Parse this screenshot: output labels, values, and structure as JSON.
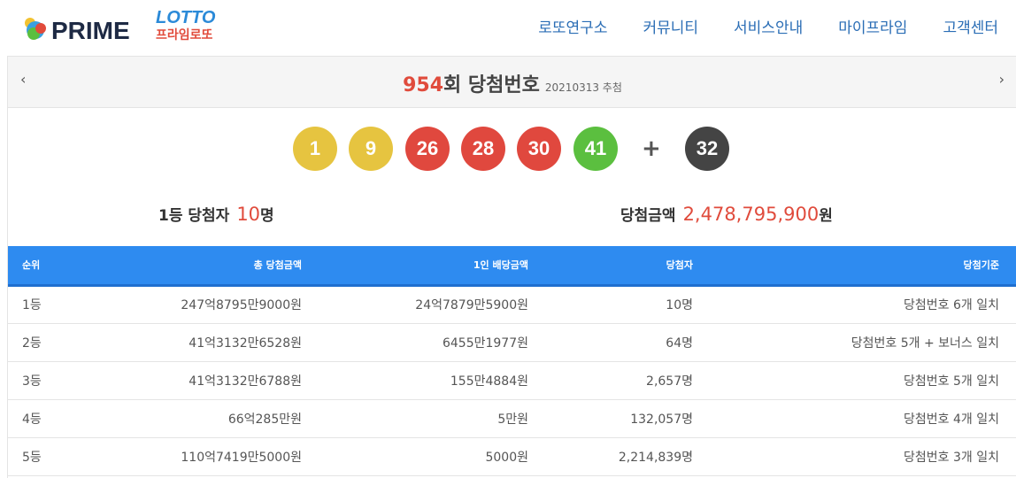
{
  "brand": {
    "name": "PRIME",
    "lotto": "LOTTO",
    "kr": "프라임로또"
  },
  "nav": [
    "로또연구소",
    "커뮤니티",
    "서비스안내",
    "마이프라임",
    "고객센터"
  ],
  "round": {
    "number": "954",
    "suffix": "회 당첨번호",
    "date": "20210313 추첨",
    "prev_icon": "‹",
    "next_icon": "›"
  },
  "balls": [
    {
      "num": "1",
      "color": "#e6c440"
    },
    {
      "num": "9",
      "color": "#e6c440"
    },
    {
      "num": "26",
      "color": "#e0483e"
    },
    {
      "num": "28",
      "color": "#e0483e"
    },
    {
      "num": "30",
      "color": "#e0483e"
    },
    {
      "num": "41",
      "color": "#5bbf3f"
    }
  ],
  "plus": "+",
  "bonus": {
    "num": "32",
    "color": "#444444"
  },
  "summary": {
    "winners_label": "1등 당첨자",
    "winners_value": "10",
    "winners_unit": "명",
    "amount_label": "당첨금액",
    "amount_value": "2,478,795,900",
    "amount_unit": "원"
  },
  "table": {
    "headers": [
      "순위",
      "총 당첨금액",
      "1인 배당금액",
      "당첨자",
      "당첨기준"
    ],
    "rows": [
      [
        "1등",
        "247억8795만9000원",
        "24억7879만5900원",
        "10명",
        "당첨번호 6개 일치"
      ],
      [
        "2등",
        "41억3132만6528원",
        "6455만1977원",
        "64명",
        "당첨번호 5개 + 보너스 일치"
      ],
      [
        "3등",
        "41억3132만6788원",
        "155만4884원",
        "2,657명",
        "당첨번호 5개 일치"
      ],
      [
        "4등",
        "66억285만원",
        "5만원",
        "132,057명",
        "당첨번호 4개 일치"
      ],
      [
        "5등",
        "110억7419만5000원",
        "5000원",
        "2,214,839명",
        "당첨번호 3개 일치"
      ]
    ]
  }
}
